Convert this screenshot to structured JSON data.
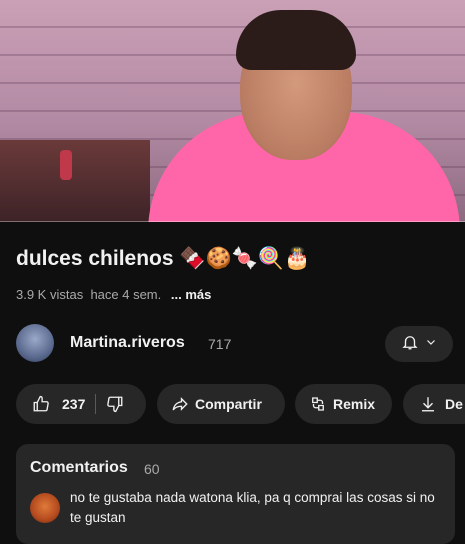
{
  "video": {
    "progress_fraction": 0.0
  },
  "title": "dulces chilenos 🍫🍪🍬🍭🎂",
  "meta": {
    "views": "3.9 K vistas",
    "date": "hace 4 sem.",
    "more": "... más"
  },
  "channel": {
    "name": "Martina.riveros",
    "subscribers": "717"
  },
  "actions": {
    "likes": "237",
    "share_label": "Compartir",
    "remix_label": "Remix",
    "download_label": "De"
  },
  "comments": {
    "heading": "Comentarios",
    "count": "60",
    "top_comment": "no te gustaba nada watona klia, pa  q comprai las cosas si no te gustan"
  },
  "colors": {
    "background": "#0f0f0f",
    "pill": "#272727",
    "shirt": "#ff66a9",
    "progress": "#ff0033"
  }
}
